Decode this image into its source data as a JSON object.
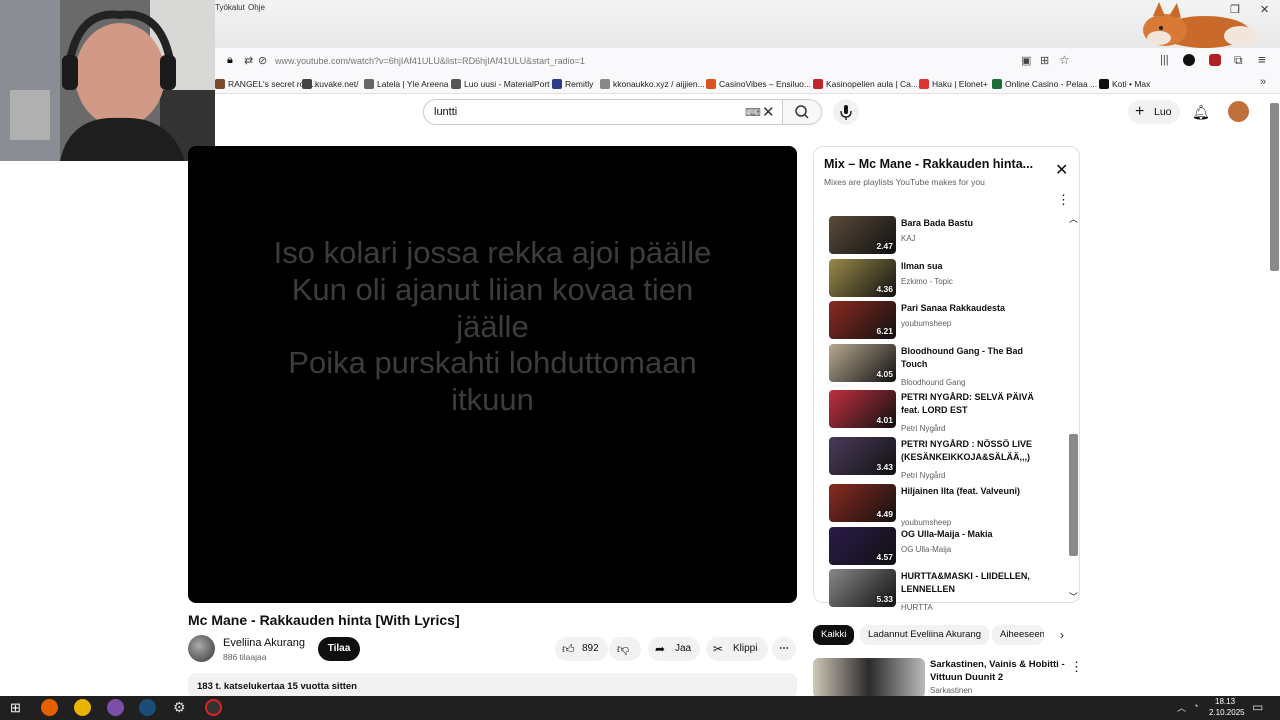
{
  "browser": {
    "menu": [
      "Työkalut",
      "Ohje"
    ],
    "url": "www.youtube.com/watch?v=6hjIAf41ULU&list=RD6hjIAf41ULU&start_radio=1",
    "bookmarks": [
      {
        "label": "RANGEL's secret roo...",
        "color": "#7a4b2a"
      },
      {
        "label": "kuvake.net/",
        "color": "#444"
      },
      {
        "label": "Latela | Yle Areena",
        "color": "#666"
      },
      {
        "label": "Luo uusi - MaterialPort",
        "color": "#555"
      },
      {
        "label": "Remitly",
        "color": "#2a3b8f"
      },
      {
        "label": "kkonaukko.xyz / aijjien...",
        "color": "#888"
      },
      {
        "label": "CasinoVibes – Ensiluo...",
        "color": "#d9541c"
      },
      {
        "label": "Kasinopelien aula | Ca...",
        "color": "#c0262d"
      },
      {
        "label": "Haku | Elonet+",
        "color": "#d33"
      },
      {
        "label": "Online Casino - Pelaa ...",
        "color": "#1b6d35"
      },
      {
        "label": "Koti • Max",
        "color": "#111"
      }
    ]
  },
  "header": {
    "search_value": "luntti",
    "create_label": "Luo"
  },
  "video": {
    "lyrics": [
      "Iso kolari jossa rekka ajoi päälle",
      "Kun oli ajanut liian kovaa tien",
      "jäälle",
      "Poika purskahti lohduttomaan",
      "itkuun"
    ],
    "title": "Mc Mane - Rakkauden hinta [With Lyrics]",
    "channel": "Eveliina Akurang",
    "subscribers": "886 tilaajaa",
    "subscribe_label": "Tilaa",
    "likes": "892",
    "share_label": "Jaa",
    "clip_label": "Klippi",
    "stats": "183 t. katselukertaa  15 vuotta sitten"
  },
  "playlist": {
    "title": "Mix – Mc Mane - Rakkauden hinta...",
    "subtitle": "Mixes are playlists YouTube makes for you",
    "items": [
      {
        "title": "Bara Bada Bastu",
        "channel": "KAJ",
        "duration": "2.47",
        "color": "#5a4a3a"
      },
      {
        "title": "Ilman sua",
        "channel": "Ezkimo - Topic",
        "duration": "4.36",
        "color": "#9a8a4a"
      },
      {
        "title": "Pari Sanaa Rakkaudesta",
        "channel": "youbumsheep",
        "duration": "6.21",
        "color": "#8a2a20"
      },
      {
        "title": "Bloodhound Gang - The Bad Touch",
        "channel": "Bloodhound Gang",
        "duration": "4.05",
        "color": "#b8a890"
      },
      {
        "title": "PETRI NYGÅRD: SELVÄ PÄIVÄ feat. LORD EST",
        "channel": "Petri Nygård",
        "duration": "4.01",
        "color": "#c03040"
      },
      {
        "title": "PETRI NYGÅRD : NÖSSÖ LIVE (KESÄNKEIKKOJA&SÄLÄÄ,,,)",
        "channel": "Petri Nygård",
        "duration": "3.43",
        "color": "#4a3a5a"
      },
      {
        "title": "Hiljainen Ilta (feat. Valveuni)",
        "channel": "youbumsheep",
        "duration": "4.49",
        "color": "#8a2a20"
      },
      {
        "title": "OG Ulla-Maija - Makia",
        "channel": "OG Ulla-Maija",
        "duration": "4.57",
        "color": "#2a1a4a"
      },
      {
        "title": "HURTTA&MASKI - LIIDELLEN, LENNELLEN",
        "channel": "HURTTA",
        "duration": "5.33",
        "color": "#888"
      }
    ]
  },
  "chips": [
    "Kaikki",
    "Ladannut Eveliina Akurang",
    "Aiheeseen"
  ],
  "recommendation": {
    "title": "Sarkastinen, Vainis & Hobitti - Vittuun Duunit 2",
    "channel": "Sarkastinen"
  },
  "taskbar": {
    "time": "18.13",
    "date": "2.10.2025"
  }
}
